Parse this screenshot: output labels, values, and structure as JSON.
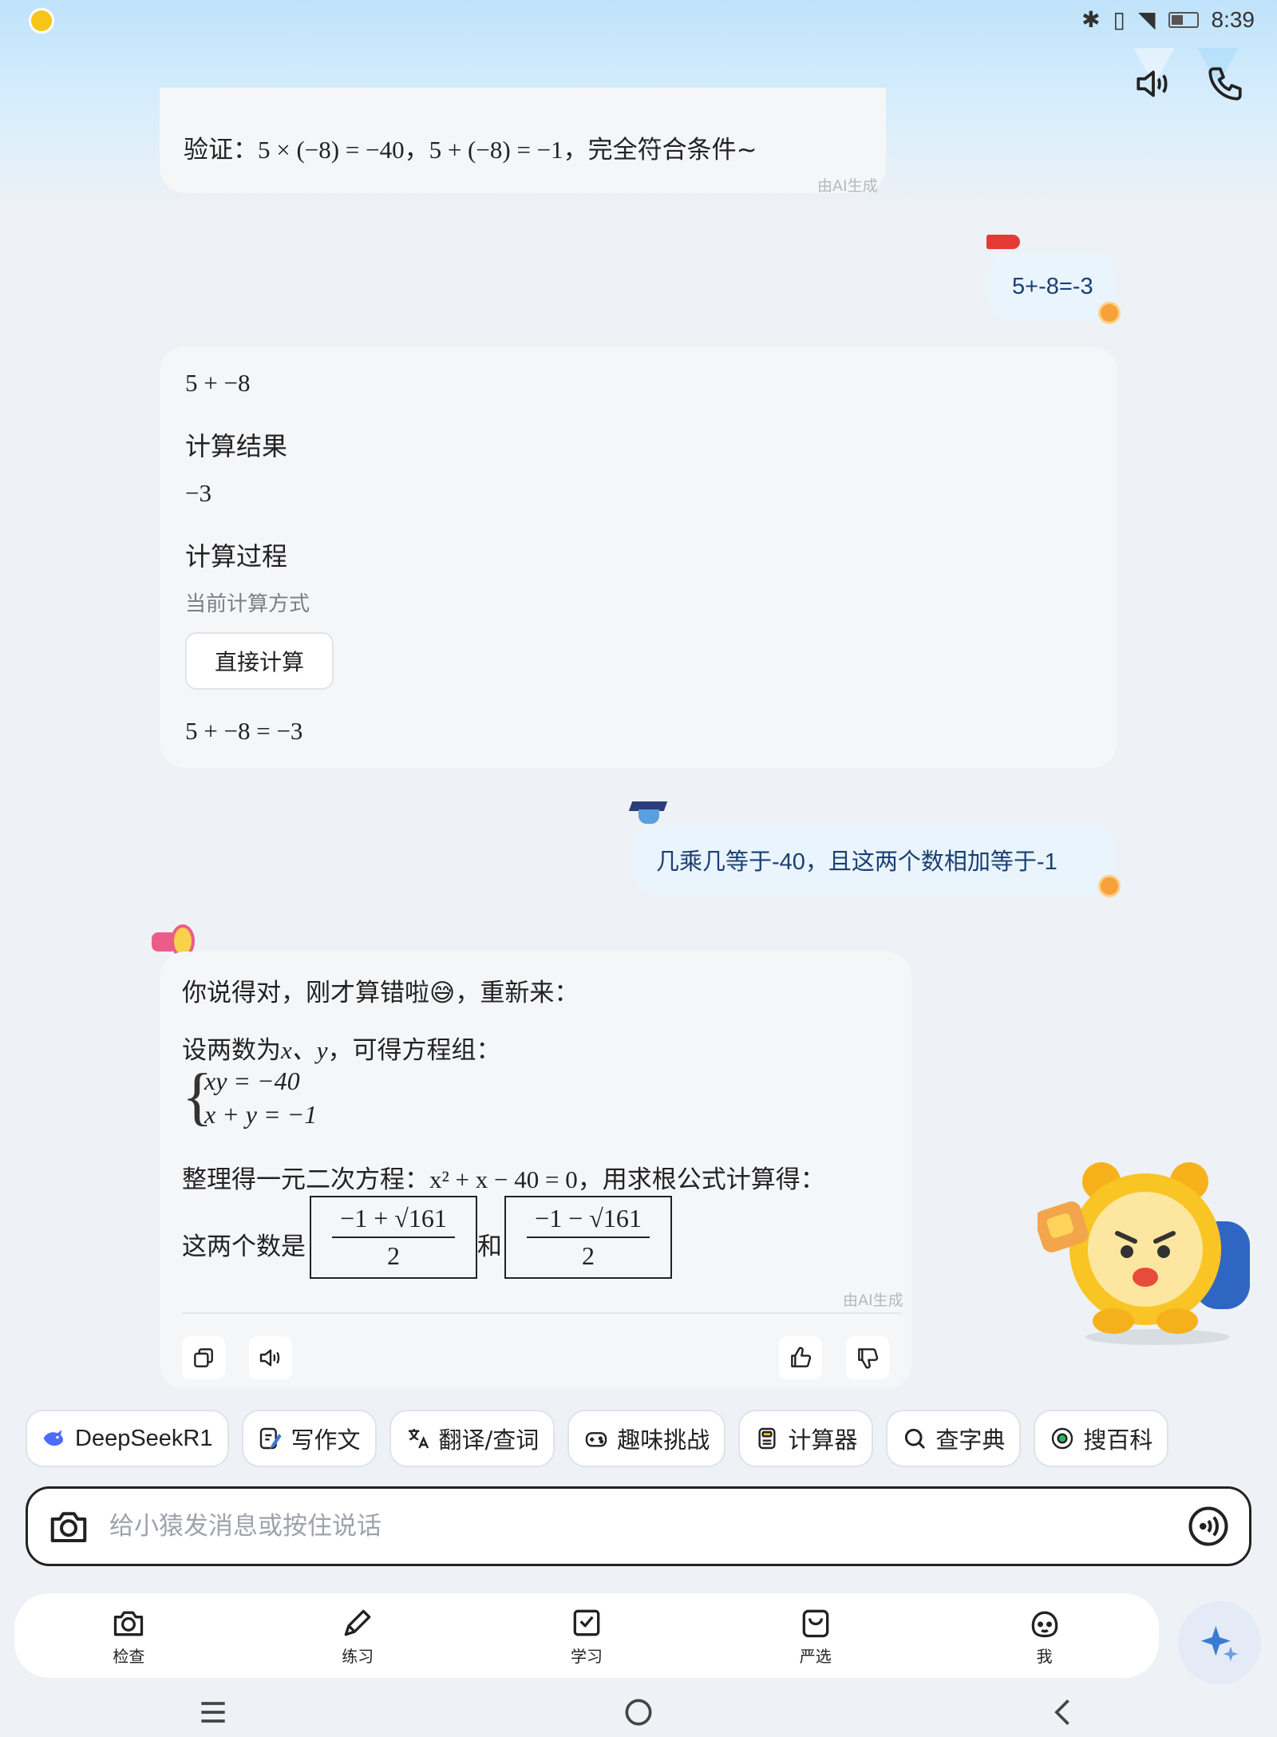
{
  "status_bar": {
    "time": "8:39"
  },
  "messages": {
    "ai_1": {
      "label": "验证：",
      "math": "5 × (−8) = −40，5 + (−8) = −1",
      "suffix": "，完全符合条件~",
      "ai_tag": "由AI生成"
    },
    "user_1": {
      "text": "5+-8=-3"
    },
    "ai_2": {
      "expression": "5 + −8",
      "result_heading": "计算结果",
      "result_value": "−3",
      "process_heading": "计算过程",
      "mode_label": "当前计算方式",
      "mode_button": "直接计算",
      "equation": "5 + −8 = −3"
    },
    "user_2": {
      "text": "几乘几等于-40，且这两个数相加等于-1"
    },
    "ai_3": {
      "intro": "你说得对，刚才算错啦😅，重新来：",
      "setup_prefix": "设两数为",
      "setup_vars": "x、y",
      "setup_suffix": "，可得方程组：",
      "eq1": "xy = −40",
      "eq2": "x + y = −1",
      "quad_prefix": "整理得一元二次方程：",
      "quad_eq": "x² + x − 40 = 0",
      "quad_suffix": "，用求根公式计算得：",
      "answer_prefix": "这两个数是",
      "answer_conj": "和",
      "root1_num": "−1 + √161",
      "root2_num": "−1 − √161",
      "root_den": "2",
      "ai_tag": "由AI生成"
    }
  },
  "quick_actions": [
    {
      "label": "DeepSeekR1",
      "icon": "whale-icon"
    },
    {
      "label": "写作文",
      "icon": "pen-doc-icon"
    },
    {
      "label": "翻译/查词",
      "icon": "translate-icon"
    },
    {
      "label": "趣味挑战",
      "icon": "gamepad-icon"
    },
    {
      "label": "计算器",
      "icon": "calculator-icon"
    },
    {
      "label": "查字典",
      "icon": "search-icon"
    },
    {
      "label": "搜百科",
      "icon": "compass-icon"
    }
  ],
  "input": {
    "placeholder": "给小猿发消息或按住说话"
  },
  "tabs": [
    {
      "label": "检查",
      "icon": "camera-icon"
    },
    {
      "label": "练习",
      "icon": "pencil-icon"
    },
    {
      "label": "学习",
      "icon": "book-check-icon"
    },
    {
      "label": "严选",
      "icon": "shopping-bag-icon"
    },
    {
      "label": "我",
      "icon": "face-icon"
    }
  ],
  "colors": {
    "user_bubble": "#e9f4fd",
    "user_text": "#1a3f73",
    "ai_bubble": "#f5f6f8",
    "accent": "#3a7bd5"
  }
}
